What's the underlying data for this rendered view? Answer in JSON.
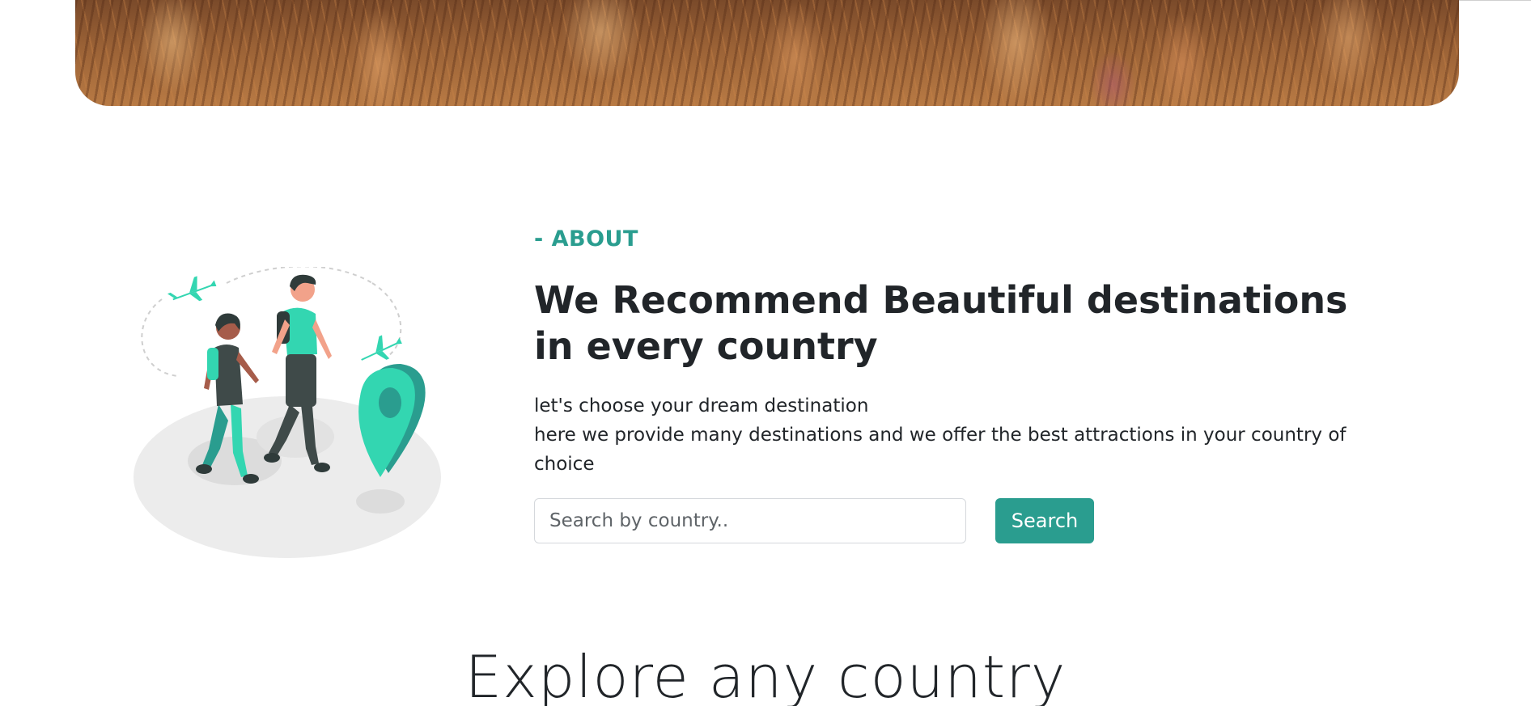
{
  "hero": {
    "image": "wheat-field-photo"
  },
  "about": {
    "tag": "- ABOUT",
    "title": "We Recommend Beautiful destinations in every country",
    "text_line1": "let's choose your dream destination",
    "text_line2": "here we provide many destinations and we offer the best attractions in your country of choice",
    "illustration": "travelers-walking-illustration"
  },
  "search": {
    "placeholder": "Search by country..",
    "value": "",
    "button_label": "Search"
  },
  "explore": {
    "title": "Explore any country"
  },
  "colors": {
    "accent": "#2a9d8f",
    "text": "#212529",
    "illustration_green": "#33d6b1"
  }
}
